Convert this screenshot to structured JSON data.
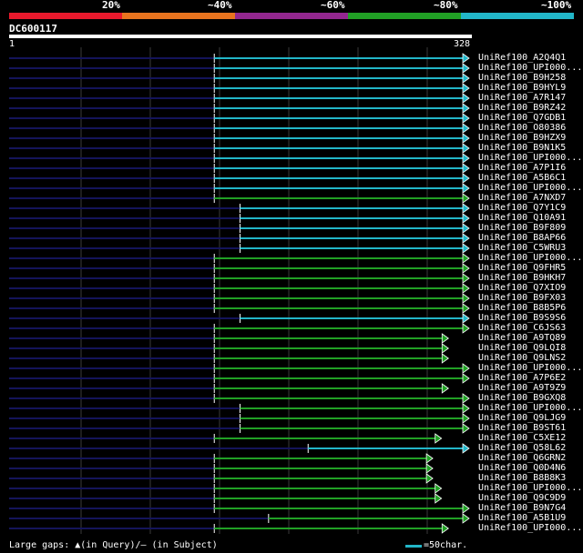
{
  "legend": {
    "labels": [
      "20%",
      "~40%",
      "~60%",
      "~80%",
      "~100%"
    ],
    "colors": [
      "#e8192c",
      "#e8731e",
      "#93278f",
      "#21a025",
      "#22b6c8"
    ]
  },
  "query": {
    "id": "DC600117",
    "start": "1",
    "end": "328"
  },
  "hits": [
    {
      "label": "UniRef100_A2Q4Q1",
      "color": "#22b6c8",
      "start": 0.446,
      "end": 1.0
    },
    {
      "label": "UniRef100_UPI000...",
      "color": "#22b6c8",
      "start": 0.446,
      "end": 1.0
    },
    {
      "label": "UniRef100_B9H258",
      "color": "#22b6c8",
      "start": 0.446,
      "end": 1.0
    },
    {
      "label": "UniRef100_B9HYL9",
      "color": "#22b6c8",
      "start": 0.446,
      "end": 1.0
    },
    {
      "label": "UniRef100_A7R147",
      "color": "#22b6c8",
      "start": 0.446,
      "end": 1.0
    },
    {
      "label": "UniRef100_B9RZ42",
      "color": "#22b6c8",
      "start": 0.446,
      "end": 1.0
    },
    {
      "label": "UniRef100_Q7GDB1",
      "color": "#22b6c8",
      "start": 0.446,
      "end": 1.0
    },
    {
      "label": "UniRef100_O80386",
      "color": "#22b6c8",
      "start": 0.446,
      "end": 1.0
    },
    {
      "label": "UniRef100_B9HZX9",
      "color": "#22b6c8",
      "start": 0.446,
      "end": 1.0
    },
    {
      "label": "UniRef100_B9N1K5",
      "color": "#22b6c8",
      "start": 0.446,
      "end": 1.0
    },
    {
      "label": "UniRef100_UPI000...",
      "color": "#22b6c8",
      "start": 0.446,
      "end": 1.0
    },
    {
      "label": "UniRef100_A7P1I6",
      "color": "#22b6c8",
      "start": 0.446,
      "end": 1.0
    },
    {
      "label": "UniRef100_A5B6C1",
      "color": "#22b6c8",
      "start": 0.446,
      "end": 1.0
    },
    {
      "label": "UniRef100_UPI000...",
      "color": "#22b6c8",
      "start": 0.446,
      "end": 1.0
    },
    {
      "label": "UniRef100_A7NXD7",
      "color": "#21a025",
      "start": 0.446,
      "end": 1.0
    },
    {
      "label": "UniRef100_Q7Y1C9",
      "color": "#22b6c8",
      "start": 0.502,
      "end": 1.0
    },
    {
      "label": "UniRef100_Q10A91",
      "color": "#22b6c8",
      "start": 0.502,
      "end": 1.0
    },
    {
      "label": "UniRef100_B9F809",
      "color": "#22b6c8",
      "start": 0.502,
      "end": 1.0
    },
    {
      "label": "UniRef100_B8AP66",
      "color": "#22b6c8",
      "start": 0.502,
      "end": 1.0
    },
    {
      "label": "UniRef100_C5WRU3",
      "color": "#22b6c8",
      "start": 0.502,
      "end": 1.0
    },
    {
      "label": "UniRef100_UPI000...",
      "color": "#21a025",
      "start": 0.446,
      "end": 1.0
    },
    {
      "label": "UniRef100_Q9FHR5",
      "color": "#21a025",
      "start": 0.446,
      "end": 1.0
    },
    {
      "label": "UniRef100_B9HKH7",
      "color": "#21a025",
      "start": 0.446,
      "end": 1.0
    },
    {
      "label": "UniRef100_Q7XIO9",
      "color": "#21a025",
      "start": 0.446,
      "end": 1.0
    },
    {
      "label": "UniRef100_B9FX03",
      "color": "#21a025",
      "start": 0.446,
      "end": 1.0
    },
    {
      "label": "UniRef100_B8B5P6",
      "color": "#21a025",
      "start": 0.446,
      "end": 1.0
    },
    {
      "label": "UniRef100_B9S9S6",
      "color": "#22b6c8",
      "start": 0.502,
      "end": 1.0
    },
    {
      "label": "UniRef100_C6JS63",
      "color": "#21a025",
      "start": 0.446,
      "end": 1.0
    },
    {
      "label": "UniRef100_A9TQ89",
      "color": "#21a025",
      "start": 0.446,
      "end": 0.955
    },
    {
      "label": "UniRef100_Q9LQI8",
      "color": "#21a025",
      "start": 0.446,
      "end": 0.955
    },
    {
      "label": "UniRef100_Q9LNS2",
      "color": "#21a025",
      "start": 0.446,
      "end": 0.955
    },
    {
      "label": "UniRef100_UPI000...",
      "color": "#21a025",
      "start": 0.446,
      "end": 1.0
    },
    {
      "label": "UniRef100_A7P6E2",
      "color": "#21a025",
      "start": 0.446,
      "end": 1.0
    },
    {
      "label": "UniRef100_A9T9Z9",
      "color": "#21a025",
      "start": 0.446,
      "end": 0.955
    },
    {
      "label": "UniRef100_B9GXQ8",
      "color": "#21a025",
      "start": 0.446,
      "end": 1.0
    },
    {
      "label": "UniRef100_UPI000...",
      "color": "#21a025",
      "start": 0.502,
      "end": 1.0
    },
    {
      "label": "UniRef100_Q9LJG9",
      "color": "#21a025",
      "start": 0.502,
      "end": 1.0
    },
    {
      "label": "UniRef100_B9ST61",
      "color": "#21a025",
      "start": 0.502,
      "end": 1.0
    },
    {
      "label": "UniRef100_C5XE12",
      "color": "#21a025",
      "start": 0.446,
      "end": 0.94
    },
    {
      "label": "UniRef100_Q58L62",
      "color": "#22b6c8",
      "start": 0.65,
      "end": 1.0
    },
    {
      "label": "UniRef100_Q6GRN2",
      "color": "#21a025",
      "start": 0.446,
      "end": 0.921
    },
    {
      "label": "UniRef100_Q0D4N6",
      "color": "#21a025",
      "start": 0.446,
      "end": 0.921
    },
    {
      "label": "UniRef100_B8B8K3",
      "color": "#21a025",
      "start": 0.446,
      "end": 0.921
    },
    {
      "label": "UniRef100_UPI000...",
      "color": "#21a025",
      "start": 0.446,
      "end": 0.94
    },
    {
      "label": "UniRef100_Q9C9D9",
      "color": "#21a025",
      "start": 0.446,
      "end": 0.94
    },
    {
      "label": "UniRef100_B9N7G4",
      "color": "#21a025",
      "start": 0.446,
      "end": 1.0
    },
    {
      "label": "UniRef100_A5B1U9",
      "color": "#21a025",
      "start": 0.564,
      "end": 1.0
    },
    {
      "label": "UniRef100_UPI000...",
      "color": "#21a025",
      "start": 0.446,
      "end": 0.955
    }
  ],
  "footer": {
    "gaps_text": "Large gaps: ▲(in Query)/‒ (in Subject)",
    "scale_text": "=50char."
  }
}
